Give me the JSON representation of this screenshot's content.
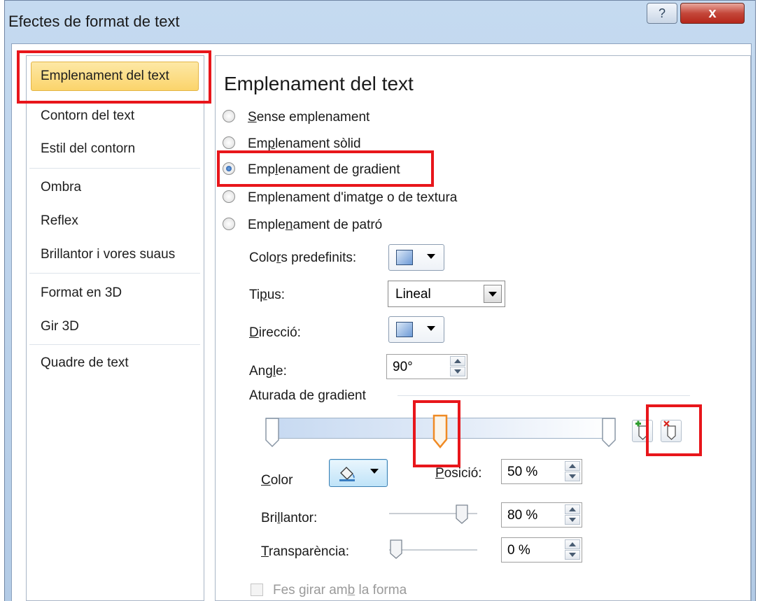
{
  "window": {
    "title": "Efectes de format de text",
    "help_glyph": "?",
    "close_glyph": "x"
  },
  "nav": {
    "items": [
      {
        "label": "Emplenament del text",
        "selected": true
      },
      {
        "label": "Contorn del text"
      },
      {
        "label": "Estil del contorn"
      },
      {
        "label": "Ombra"
      },
      {
        "label": "Reflex"
      },
      {
        "label": "Brillantor i vores suaus"
      },
      {
        "label": "Format en 3D"
      },
      {
        "label": "Gir 3D"
      },
      {
        "label": "Quadre de text"
      }
    ]
  },
  "panel": {
    "heading": "Emplenament del text",
    "fill_options": [
      {
        "pre": "",
        "key": "S",
        "post": "ense emplenament",
        "checked": false
      },
      {
        "pre": "Em",
        "key": "p",
        "post": "lenament sòlid",
        "checked": false
      },
      {
        "pre": "Emp",
        "key": "l",
        "post": "enament de gradient",
        "checked": true
      },
      {
        "pre": "Emplenament d'imat",
        "key": "g",
        "post": "e o de textura",
        "checked": false
      },
      {
        "pre": "Emple",
        "key": "n",
        "post": "ament de patró",
        "checked": false
      }
    ],
    "preset_colors": {
      "pre": "Colo",
      "key": "r",
      "post": "s predefinits:"
    },
    "type": {
      "pre": "Ti",
      "key": "p",
      "post": "us:",
      "value": "Lineal"
    },
    "direction": {
      "pre": "",
      "key": "D",
      "post": "irecció:"
    },
    "angle": {
      "pre": "Ang",
      "key": "l",
      "post": "e:",
      "value": "90°"
    },
    "gradient_stops": {
      "label": "Aturada de gradient",
      "selected_stop_position_pct": 50,
      "stop_positions_pct": [
        0,
        50,
        100
      ]
    },
    "color": {
      "pre": "",
      "key": "C",
      "post": "olor"
    },
    "position": {
      "pre": "",
      "key": "P",
      "post": "osició:",
      "value": "50 %"
    },
    "brightness": {
      "pre": "Bri",
      "key": "l",
      "post": "lantor:",
      "value": "80 %",
      "slider_pct": 80
    },
    "transparency": {
      "pre": "",
      "key": "T",
      "post": "ransparència:",
      "value": "0 %",
      "slider_pct": 0
    },
    "rotate_with_shape": {
      "pre": "Fes girar am",
      "key": "b",
      "post": " la forma",
      "checked": false,
      "enabled": false
    }
  },
  "colors": {
    "highlight": "#e8161b",
    "nav_selected": "#fbd46b",
    "selected_stop_outline": "#f08a24"
  },
  "icons": [
    "help-icon",
    "close-icon",
    "gradient-swatch-icon",
    "dropdown-arrow-icon",
    "paint-bucket-icon",
    "add-stop-icon",
    "remove-stop-icon"
  ]
}
